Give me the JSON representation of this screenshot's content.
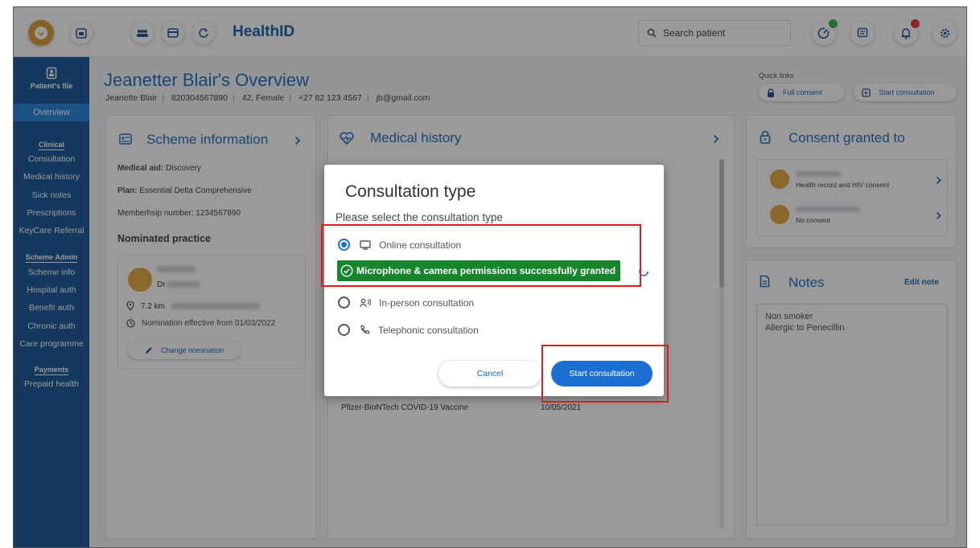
{
  "app": {
    "title": "HealthID"
  },
  "topbar": {
    "search_placeholder": "Search patient"
  },
  "colors": {
    "primary": "#0d4e92",
    "accent": "#1a6fd1",
    "success": "#18852d",
    "highlight": "#e11b1b"
  },
  "sidebar": {
    "patient_file": "Patient's file",
    "active": "Overview",
    "sections": [
      {
        "heading": "Clinical",
        "items": [
          "Consultation",
          "Medical history",
          "Sick notes",
          "Prescriptions",
          "KeyCare Referral"
        ]
      },
      {
        "heading": "Scheme Admin",
        "items": [
          "Scheme info",
          "Hospital auth",
          "Benefit auth",
          "Chronic auth",
          "Care programme"
        ]
      },
      {
        "heading": "Payments",
        "items": [
          "Prepaid health"
        ]
      }
    ]
  },
  "overview": {
    "title": "Jeanetter Blair's Overview",
    "name": "Jeanette Blair",
    "id_number": "820304567890",
    "age_gender": "42, Female",
    "phone": "+27 82 123 4567",
    "email": "jb@gmail.com"
  },
  "quick_links": {
    "label": "Quick links",
    "full_consent": "Full consent",
    "start_consultation": "Start consultation"
  },
  "scheme": {
    "title": "Scheme information",
    "medical_aid_label": "Medical aid:",
    "medical_aid": "Discovery",
    "plan_label": "Plan:",
    "plan": "Essential Delta Comprehensive",
    "membership_label": "Memberhsip number:",
    "membership": "1234567890",
    "nominated": "Nominated practice",
    "doctor_prefix": "Dr",
    "distance": "7.2 km",
    "effective": "Nomination effective from 01/03/2022",
    "change_button": "Change nomination"
  },
  "medical_history": {
    "title": "Medical history",
    "vaccine": "Pfizer-BioNTech COVID-19 Vaccine",
    "vaccine_date": "10/05/2021"
  },
  "consent": {
    "title": "Consent granted to",
    "entry1": "Health record and HIV consent",
    "entry2": "No consent"
  },
  "notes": {
    "title": "Notes",
    "edit": "Edit note",
    "line1": "Non smoker",
    "line2": "Allergic to Penecillin"
  },
  "modal": {
    "title": "Consultation type",
    "subtitle": "Please select the consultation type",
    "options": [
      "Online consultation",
      "In-person consultation",
      "Telephonic consultation"
    ],
    "selected": "Online consultation",
    "permission": "Microphone & camera permissions successfully granted",
    "cancel": "Cancel",
    "start": "Start consultation"
  }
}
